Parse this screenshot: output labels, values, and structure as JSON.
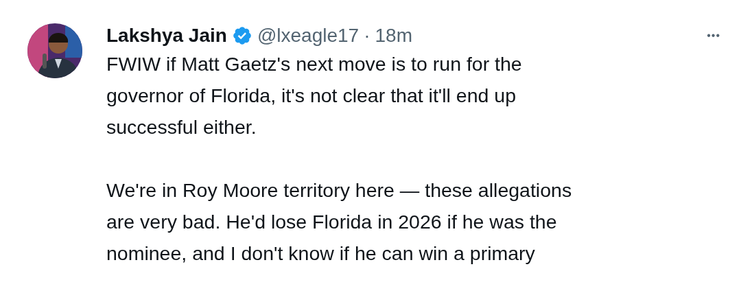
{
  "post": {
    "author": {
      "name": "Lakshya Jain",
      "verified": true
    },
    "handle": "@lxeagle17",
    "separator": "·",
    "time": "18m",
    "more": "•••",
    "paragraphs": [
      [
        "FWIW if Matt Gaetz's next move is to run for the",
        "governor of Florida, it's not clear that it'll end up",
        "successful either."
      ],
      [
        "We're in Roy Moore territory here — these allegations",
        "are very bad. He'd lose Florida in 2026 if he was the",
        "nominee, and I don't know if he can win a primary"
      ]
    ]
  }
}
